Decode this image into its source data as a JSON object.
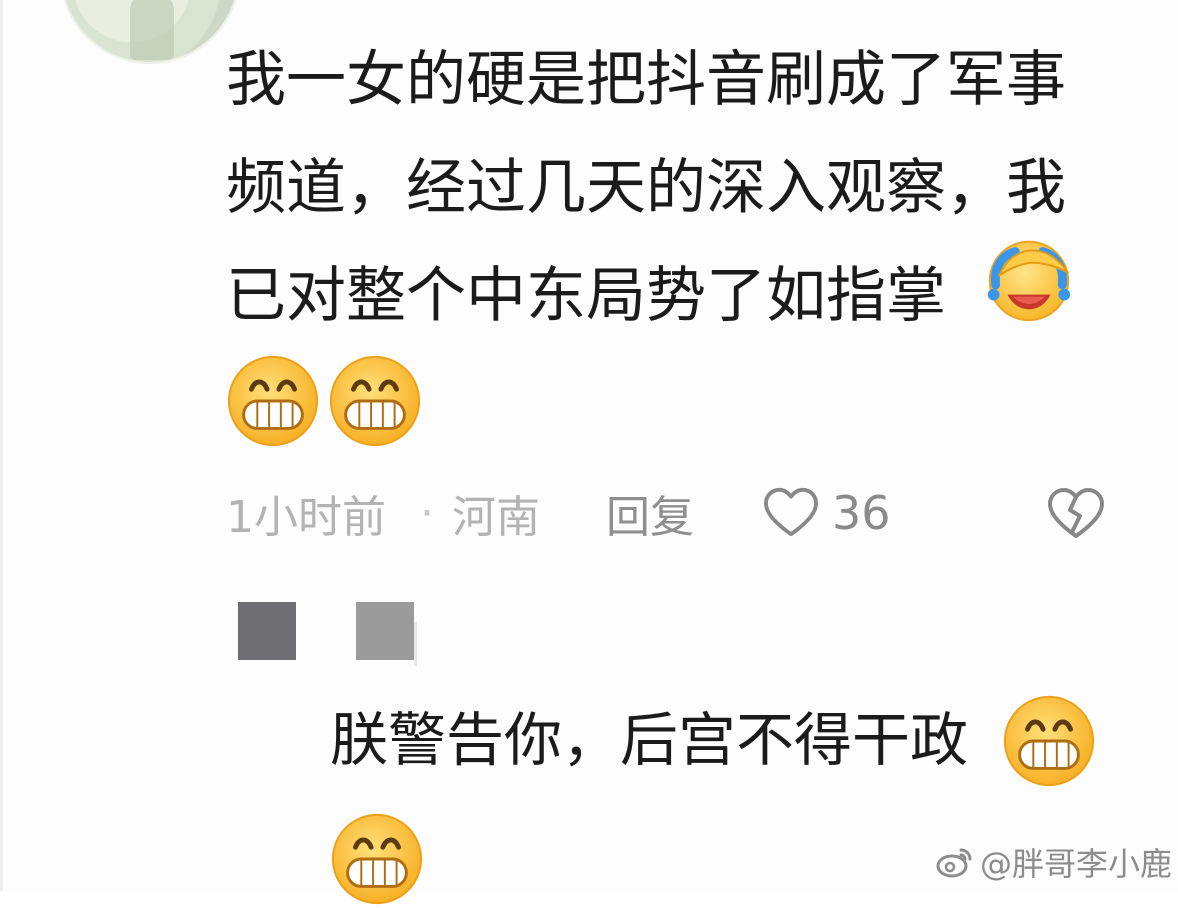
{
  "comment": {
    "lines": [
      "我一女的硬是把抖音刷成了军事",
      "频道，经过几天的深入观察，我",
      "已对整个中东局势了如指掌"
    ],
    "meta": {
      "time": "1小时前",
      "dot": "·",
      "location": "河南",
      "reply": "回复",
      "likes": "36"
    },
    "emojis": [
      "laugh-cry-icon",
      "grin-icon",
      "grin-icon"
    ]
  },
  "reply": {
    "text": "朕警告你，后宫不得干政",
    "emojis": [
      "grin-icon",
      "grin-icon"
    ]
  },
  "watermark": {
    "text": "@胖哥李小鹿"
  },
  "colors": {
    "text": "#1b1b1b",
    "meta": "#b3b3b3",
    "action": "#8f8f8f",
    "emoji_face": "#ffc83a",
    "emoji_outline": "#f5a623"
  }
}
